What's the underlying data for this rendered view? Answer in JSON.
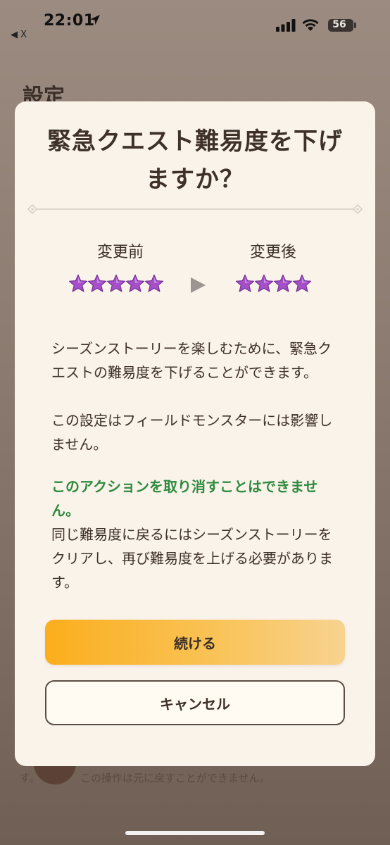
{
  "status_bar": {
    "time": "22:01",
    "back_app": "◀ X",
    "battery": "56"
  },
  "background": {
    "title": "設定",
    "note_left": "す。",
    "note": "この操作は元に戻すことができません。"
  },
  "dialog": {
    "title": "緊急クエスト難易度を下げますか？",
    "before_label": "変更前",
    "after_label": "変更後",
    "before_stars": 5,
    "after_stars": 4,
    "paragraph1": "シーズンストーリーを楽しむために、緊急クエストの難易度を下げることができます。",
    "paragraph2": "この設定はフィールドモンスターには影響しません。",
    "warning": "このアクションを取り消すことはできません。",
    "paragraph3": "同じ難易度に戻るにはシーズンストーリーをクリアし、再び難易度を上げる必要があります。",
    "continue_label": "続ける",
    "cancel_label": "キャンセル"
  },
  "colors": {
    "star": "#a64fc9",
    "warning": "#2e8a3e",
    "primary_button": "#fbae1d"
  }
}
